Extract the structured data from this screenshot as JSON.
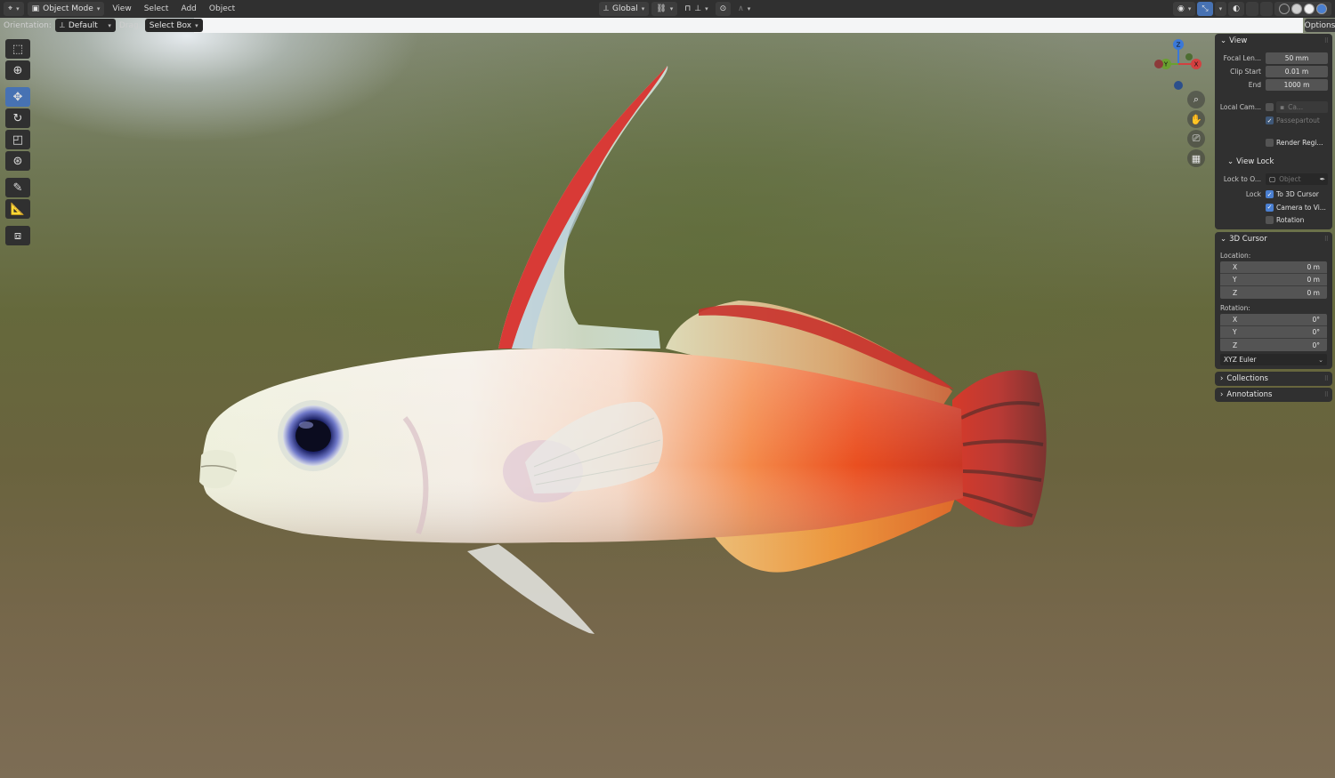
{
  "header": {
    "mode": "Object Mode",
    "menus": [
      "View",
      "Select",
      "Add",
      "Object"
    ],
    "transform_orientation": "Global",
    "shading_colors": [
      "#1a1a1a",
      "#d0d0d0",
      "#f0f0f0",
      "#4a7fd0"
    ]
  },
  "tool_header": {
    "orientation_label": "Orientation:",
    "orientation_value": "Default",
    "drag_label": "Drag:",
    "drag_value": "Select Box",
    "options_label": "Options"
  },
  "toolbar": {
    "tools": [
      "select-box",
      "cursor",
      "move",
      "rotate",
      "scale",
      "transform",
      "annotate",
      "measure",
      "add-cube"
    ],
    "active_tool": "move"
  },
  "gizmo": {
    "z": "Z",
    "y": "Y",
    "x": "X"
  },
  "npanel": {
    "view": {
      "title": "View",
      "focal_length_label": "Focal Len...",
      "focal_length_value": "50 mm",
      "clip_start_label": "Clip Start",
      "clip_start_value": "0.01 m",
      "clip_end_label": "End",
      "clip_end_value": "1000 m",
      "local_camera_label": "Local Cam...",
      "local_camera_value": "Ca...",
      "passepartout_label": "Passepartout",
      "render_region_label": "Render Regi..."
    },
    "view_lock": {
      "title": "View Lock",
      "lock_to_object_label": "Lock to O...",
      "lock_to_object_placeholder": "Object",
      "lock_label": "Lock",
      "to_3d_cursor_label": "To 3D Cursor",
      "to_3d_cursor_checked": true,
      "camera_to_view_label": "Camera to Vi...",
      "camera_to_view_checked": true,
      "rotation_label": "Rotation",
      "rotation_checked": false
    },
    "cursor": {
      "title": "3D Cursor",
      "location_label": "Location:",
      "location": [
        {
          "axis": "X",
          "value": "0 m"
        },
        {
          "axis": "Y",
          "value": "0 m"
        },
        {
          "axis": "Z",
          "value": "0 m"
        }
      ],
      "rotation_label": "Rotation:",
      "rotation": [
        {
          "axis": "X",
          "value": "0°"
        },
        {
          "axis": "Y",
          "value": "0°"
        },
        {
          "axis": "Z",
          "value": "0°"
        }
      ],
      "rotation_mode": "XYZ Euler"
    },
    "collections": {
      "title": "Collections"
    },
    "annotations": {
      "title": "Annotations"
    }
  }
}
